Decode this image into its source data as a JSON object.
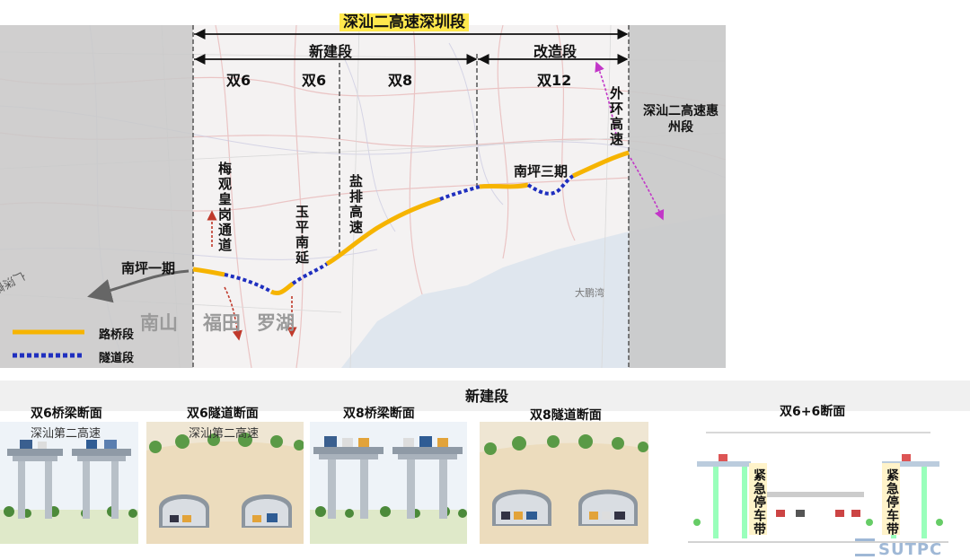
{
  "header": {
    "title": "深汕二高速深圳段"
  },
  "map": {
    "segments": {
      "new": "新建段",
      "rebuild": "改造段"
    },
    "lane_labels": [
      "双6",
      "双6",
      "双8",
      "双12"
    ],
    "road_labels": {
      "meiguan": "梅观皇岗通道",
      "yuping": "玉平南延",
      "yanpai": "盐排高速",
      "waihuan": "外环高速",
      "guangshen": "广深高速",
      "nanping1": "南坪一期",
      "nanping3": "南坪三期",
      "huizhou": "深汕二高速惠州段"
    },
    "district_labels": [
      "南山",
      "福田",
      "罗湖"
    ],
    "place_labels": {
      "dapeng": "大鹏湾"
    },
    "legend": [
      {
        "label": "路桥段",
        "color": "#f6b400",
        "style": "solid"
      },
      {
        "label": "隧道段",
        "color": "#1f2fbf",
        "style": "dotted"
      }
    ]
  },
  "sections": {
    "title": "新建段",
    "panels": [
      {
        "title": "双6桥梁断面",
        "sign": "深汕第二高速",
        "kind": "bridge"
      },
      {
        "title": "双6隧道断面",
        "sign": "深汕第二高速",
        "kind": "tunnel"
      },
      {
        "title": "双8桥梁断面",
        "sign": "",
        "kind": "bridge"
      },
      {
        "title": "双8隧道断面",
        "sign": "",
        "kind": "tunnel"
      },
      {
        "title": "双6+6断面",
        "sign": "",
        "kind": "drawing",
        "stop_lane": "紧急停车带"
      }
    ]
  },
  "footer": {
    "logo": "SUTPC"
  },
  "colors": {
    "road": "#f6b400",
    "tunnel": "#1f2fbf",
    "arrow_red": "#c0392b",
    "arrow_purple": "#c236c8",
    "highlight": "#ffe84d"
  }
}
